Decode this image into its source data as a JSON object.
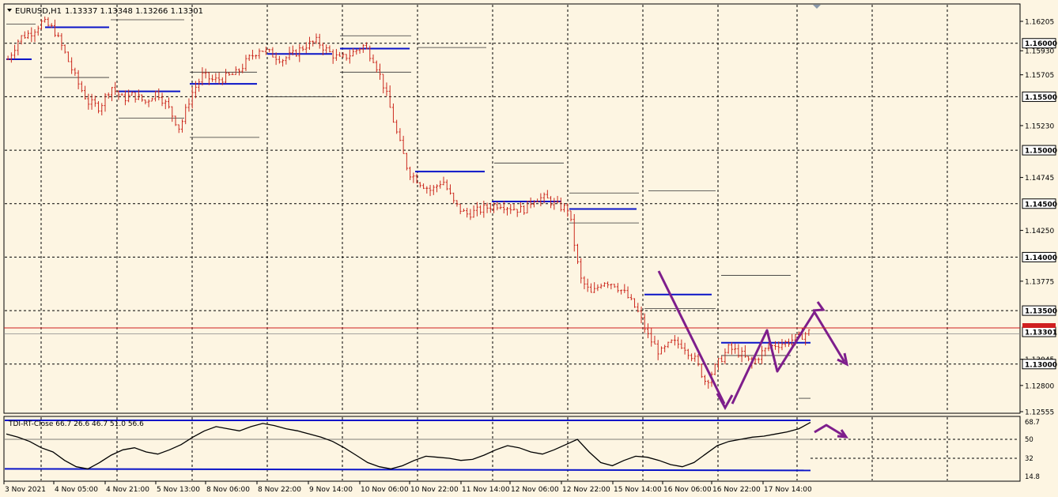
{
  "header": {
    "symbol": "EURUSD,H1",
    "ohlc": "1.13337 1.13348 1.13266 1.13301"
  },
  "indicator": {
    "label": "TDI-RT-Close 66.7 26.6 46.7 51.0 56.6",
    "top_value": "68.7"
  },
  "colors": {
    "background": "#fdf5e2",
    "grid": "#000000",
    "candle": "#cc2a1f",
    "pivot": "#0a14c8",
    "projection": "#7e1e8c",
    "price_line": "#d02020"
  },
  "chart_data": [
    {
      "type": "line",
      "title": "",
      "series_type": "candlestick-hourly",
      "y_ticks": [
        "1.16205",
        "1.15930",
        "1.15705",
        "1.15230",
        "1.14745",
        "1.14250",
        "1.13775",
        "1.13045",
        "1.12800",
        "1.12555"
      ],
      "y_ticks_boxed": [
        "1.16000",
        "1.15500",
        "1.15000",
        "1.14500",
        "1.14000",
        "1.13500",
        "1.13301",
        "1.13000"
      ],
      "ylim": [
        1.12555,
        1.16205
      ],
      "current_price": 1.13301,
      "x_ticks": [
        "3 Nov 2021",
        "4 Nov 05:00",
        "4 Nov 21:00",
        "5 Nov 13:00",
        "8 Nov 06:00",
        "8 Nov 22:00",
        "9 Nov 14:00",
        "10 Nov 06:00",
        "10 Nov 22:00",
        "11 Nov 14:00",
        "12 Nov 06:00",
        "12 Nov 22:00",
        "15 Nov 14:00",
        "16 Nov 06:00",
        "16 Nov 22:00",
        "17 Nov 14:00"
      ],
      "price_path": [
        [
          0,
          1.1585
        ],
        [
          1,
          1.1605
        ],
        [
          2,
          1.161
        ],
        [
          3,
          1.162
        ],
        [
          4,
          1.1613
        ],
        [
          5,
          1.159
        ],
        [
          6,
          1.1565
        ],
        [
          7,
          1.1545
        ],
        [
          8,
          1.154
        ],
        [
          9,
          1.156
        ],
        [
          10,
          1.1548
        ],
        [
          11,
          1.1552
        ],
        [
          12,
          1.1545
        ],
        [
          13,
          1.1555
        ],
        [
          14,
          1.154
        ],
        [
          15,
          1.152
        ],
        [
          16,
          1.1552
        ],
        [
          17,
          1.157
        ],
        [
          18,
          1.1565
        ],
        [
          19,
          1.1568
        ],
        [
          20,
          1.1572
        ],
        [
          21,
          1.1585
        ],
        [
          22,
          1.1595
        ],
        [
          23,
          1.159
        ],
        [
          24,
          1.1585
        ],
        [
          25,
          1.159
        ],
        [
          26,
          1.1598
        ],
        [
          27,
          1.1602
        ],
        [
          28,
          1.1592
        ],
        [
          29,
          1.1585
        ],
        [
          30,
          1.159
        ],
        [
          31,
          1.1598
        ],
        [
          32,
          1.1585
        ],
        [
          33,
          1.1555
        ],
        [
          34,
          1.1515
        ],
        [
          35,
          1.148
        ],
        [
          36,
          1.147
        ],
        [
          37,
          1.1462
        ],
        [
          38,
          1.1472
        ],
        [
          39,
          1.145
        ],
        [
          40,
          1.144
        ],
        [
          41,
          1.1443
        ],
        [
          42,
          1.1447
        ],
        [
          43,
          1.145
        ],
        [
          44,
          1.1446
        ],
        [
          45,
          1.1444
        ],
        [
          46,
          1.1455
        ],
        [
          47,
          1.1455
        ],
        [
          48,
          1.1448
        ],
        [
          49,
          1.1445
        ],
        [
          50,
          1.138
        ],
        [
          51,
          1.1365
        ],
        [
          52,
          1.1378
        ],
        [
          53,
          1.1375
        ],
        [
          54,
          1.1365
        ],
        [
          55,
          1.135
        ],
        [
          56,
          1.1325
        ],
        [
          57,
          1.131
        ],
        [
          58,
          1.132
        ],
        [
          59,
          1.1318
        ],
        [
          60,
          1.1305
        ],
        [
          61,
          1.1283
        ],
        [
          62,
          1.13
        ],
        [
          63,
          1.1315
        ],
        [
          64,
          1.131
        ],
        [
          65,
          1.13
        ],
        [
          66,
          1.1312
        ],
        [
          67,
          1.1318
        ],
        [
          68,
          1.132
        ],
        [
          69,
          1.1325
        ],
        [
          70,
          1.133
        ]
      ]
    },
    {
      "type": "line",
      "title": "",
      "name": "TDI-RT-Close",
      "y_ticks": [
        "68.7",
        "50",
        "32",
        "14.8"
      ],
      "ylim": [
        14.8,
        68.7
      ],
      "values": [
        55,
        52,
        48,
        42,
        38,
        30,
        24,
        22,
        28,
        35,
        40,
        42,
        38,
        36,
        40,
        45,
        52,
        58,
        62,
        60,
        58,
        62,
        65,
        63,
        60,
        58,
        55,
        52,
        48,
        42,
        35,
        28,
        24,
        22,
        25,
        30,
        34,
        33,
        32,
        30,
        31,
        35,
        40,
        44,
        42,
        38,
        36,
        40,
        45,
        50,
        38,
        28,
        25,
        30,
        34,
        33,
        30,
        26,
        24,
        28,
        36,
        44,
        48,
        50,
        52,
        53,
        55,
        57,
        60,
        66
      ]
    }
  ]
}
